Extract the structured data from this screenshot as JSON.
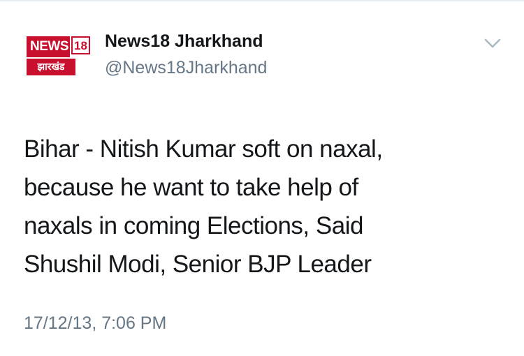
{
  "tweet": {
    "logo": {
      "top_text": "NEWS",
      "number": "18",
      "bottom_text": "झारखंड"
    },
    "author_name": "News18 Jharkhand",
    "author_handle": "@News18Jharkhand",
    "menu_icon": "chevron-down-icon",
    "text_lines": [
      "Bihar - Nitish Kumar soft on naxal,",
      "because he want to take help of",
      "naxals in coming Elections, Said",
      "Shushil Modi, Senior BJP Leader"
    ],
    "timestamp": "17/12/13, 7:06 PM"
  },
  "colors": {
    "brand_red": "#c8102e",
    "text_primary": "#14171a",
    "text_secondary": "#657786",
    "chevron": "#aab8c2"
  }
}
